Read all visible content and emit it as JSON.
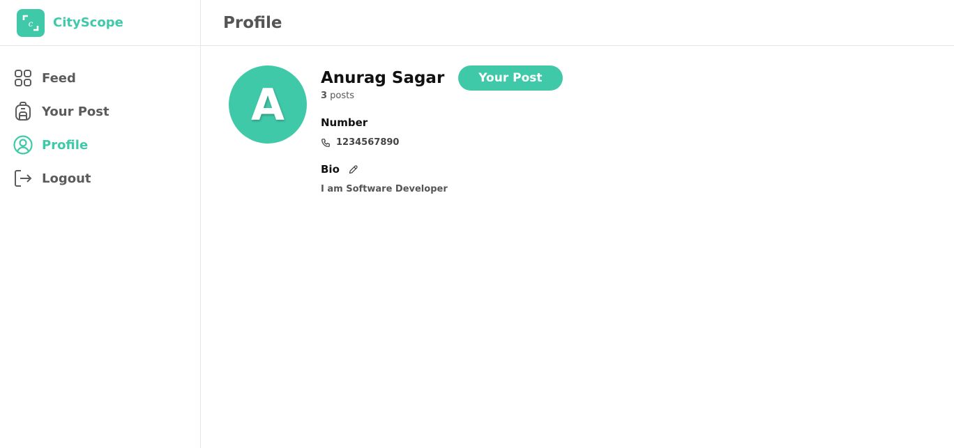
{
  "brand": {
    "logo_letter": "c",
    "name": "CityScope",
    "color": "#40c9a9"
  },
  "sidebar": {
    "items": [
      {
        "label": "Feed",
        "icon": "grid-icon",
        "active": false
      },
      {
        "label": "Your Post",
        "icon": "backpack-icon",
        "active": false
      },
      {
        "label": "Profile",
        "icon": "user-circle-icon",
        "active": true
      },
      {
        "label": "Logout",
        "icon": "logout-icon",
        "active": false
      }
    ]
  },
  "header": {
    "title": "Profile"
  },
  "profile": {
    "avatar_letter": "A",
    "name": "Anurag Sagar",
    "your_post_button": "Your Post",
    "posts_count": "3",
    "posts_suffix": " posts",
    "number_label": "Number",
    "phone": "1234567890",
    "bio_label": "Bio",
    "bio": "I am Software Developer"
  },
  "colors": {
    "accent": "#40c9a9",
    "text_muted": "#5b5b5b"
  }
}
